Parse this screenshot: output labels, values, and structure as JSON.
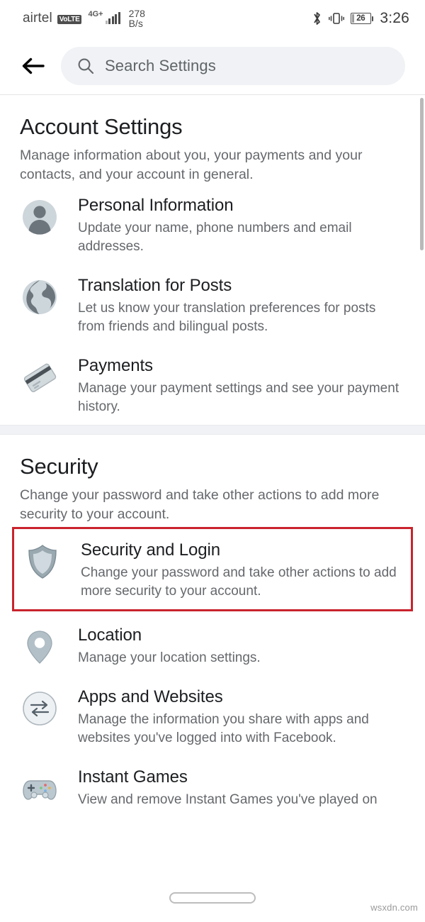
{
  "status_bar": {
    "carrier": "airtel",
    "volte_badge": "VoLTE",
    "network_gen": "4G+",
    "data_speed_value": "278",
    "data_speed_unit": "B/s",
    "battery_percent": "26",
    "clock": "3:26",
    "icons": [
      "bluetooth-icon",
      "vibrate-icon",
      "battery-icon"
    ]
  },
  "header": {
    "back_label": "Back",
    "search_placeholder": "Search Settings",
    "search_value": ""
  },
  "sections": [
    {
      "id": "account-settings",
      "title": "Account Settings",
      "subtitle": "Manage information about you, your payments and your contacts, and your account in general.",
      "items": [
        {
          "id": "personal-information",
          "icon": "person-avatar-icon",
          "title": "Personal Information",
          "subtitle": "Update your name, phone numbers and email addresses.",
          "highlighted": false
        },
        {
          "id": "translation-for-posts",
          "icon": "globe-icon",
          "title": "Translation for Posts",
          "subtitle": "Let us know your translation preferences for posts from friends and bilingual posts.",
          "highlighted": false
        },
        {
          "id": "payments",
          "icon": "credit-card-icon",
          "title": "Payments",
          "subtitle": "Manage your payment settings and see your payment history.",
          "highlighted": false
        }
      ]
    },
    {
      "id": "security",
      "title": "Security",
      "subtitle": "Change your password and take other actions to add more security to your account.",
      "items": [
        {
          "id": "security-and-login",
          "icon": "shield-icon",
          "title": "Security and Login",
          "subtitle": "Change your password and take other actions to add more security to your account.",
          "highlighted": true
        },
        {
          "id": "location",
          "icon": "location-pin-icon",
          "title": "Location",
          "subtitle": "Manage your location settings.",
          "highlighted": false
        },
        {
          "id": "apps-and-websites",
          "icon": "two-way-arrows-icon",
          "title": "Apps and Websites",
          "subtitle": "Manage the information you share with apps and websites you've logged into with Facebook.",
          "highlighted": false
        },
        {
          "id": "instant-games",
          "icon": "gamepad-icon",
          "title": "Instant Games",
          "subtitle": "View and remove Instant Games you've played on",
          "highlighted": false
        }
      ]
    }
  ],
  "footer": {
    "watermark": "wsxdn.com"
  },
  "colors": {
    "highlight_border": "#c9232d",
    "divider": "#f0f2f5",
    "search_field": "#f0f2f5",
    "title_text": "#1c1e21",
    "secondary_text": "#65686c"
  }
}
